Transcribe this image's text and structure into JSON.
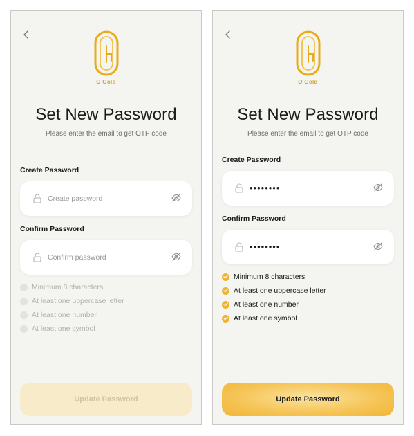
{
  "common": {
    "brand": "O Gold",
    "title": "Set New Password",
    "subtitle": "Please enter the email to get OTP code",
    "create_label": "Create Password",
    "confirm_label": "Confirm Password",
    "create_placeholder": "Create password",
    "confirm_placeholder": "Confirm password",
    "button_label": "Update Password",
    "requirements": [
      "Minimum 8 characters",
      "At least one uppercase letter",
      "At least one number",
      "At least one symbol"
    ]
  },
  "left": {
    "create_value": "",
    "confirm_value": "",
    "requirements_met": [
      false,
      false,
      false,
      false
    ],
    "button_enabled": false
  },
  "right": {
    "create_value": "••••••••",
    "confirm_value": "••••••••",
    "requirements_met": [
      true,
      true,
      true,
      true
    ],
    "button_enabled": true
  },
  "colors": {
    "accent": "#f0b32c",
    "background": "#f4f4f0",
    "disabled_button": "#f7ebc9"
  },
  "icons": [
    "back-chevron-icon",
    "o-gold-logo-icon",
    "lock-icon",
    "eye-off-icon",
    "check-circle-icon"
  ]
}
